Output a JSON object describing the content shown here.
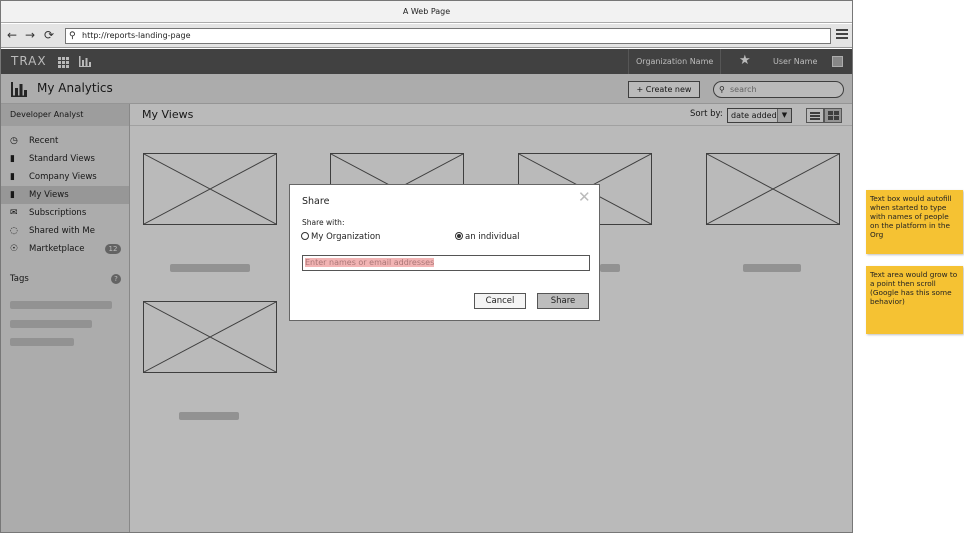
{
  "window": {
    "title": "A Web Page"
  },
  "address_bar": {
    "url": "http://reports-landing-page"
  },
  "app_bar": {
    "brand": "TRAX",
    "organization": "Organization Name",
    "user_name": "User Name"
  },
  "sub_bar": {
    "title": "My Analytics",
    "create_label": "Create new",
    "search_placeholder": "search"
  },
  "sidebar": {
    "role": "Developer Analyst",
    "items": [
      {
        "label": "Recent",
        "icon": "clock-icon"
      },
      {
        "label": "Standard Views",
        "icon": "bar-chart-icon"
      },
      {
        "label": "Company Views",
        "icon": "bar-chart-icon"
      },
      {
        "label": "My Views",
        "icon": "bar-chart-icon"
      },
      {
        "label": "Subscriptions",
        "icon": "envelope-icon"
      },
      {
        "label": "Shared with Me",
        "icon": "shared-icon"
      },
      {
        "label": "Martketplace",
        "icon": "globe-icon",
        "badge": "12"
      }
    ],
    "tags_label": "Tags"
  },
  "main": {
    "title": "My Views",
    "sort_label": "Sort by:",
    "sort_value": "date added"
  },
  "dialog": {
    "title": "Share",
    "share_with_label": "Share with:",
    "option_org": "My Organization",
    "option_individual": "an individual",
    "selected_option": "an individual",
    "names_placeholder": "Enter names or email addresses",
    "cancel_label": "Cancel",
    "share_label": "Share"
  },
  "notes": [
    "Text box would autofill when started to type with names of people on the platform in the Org",
    "Text area would grow to a point then scroll (Google has this some behavior)"
  ],
  "colors": {
    "note_yellow": "#f5c233",
    "app_bar": "#5a5a5a",
    "placeholder_highlight": "#f2b4b4"
  }
}
